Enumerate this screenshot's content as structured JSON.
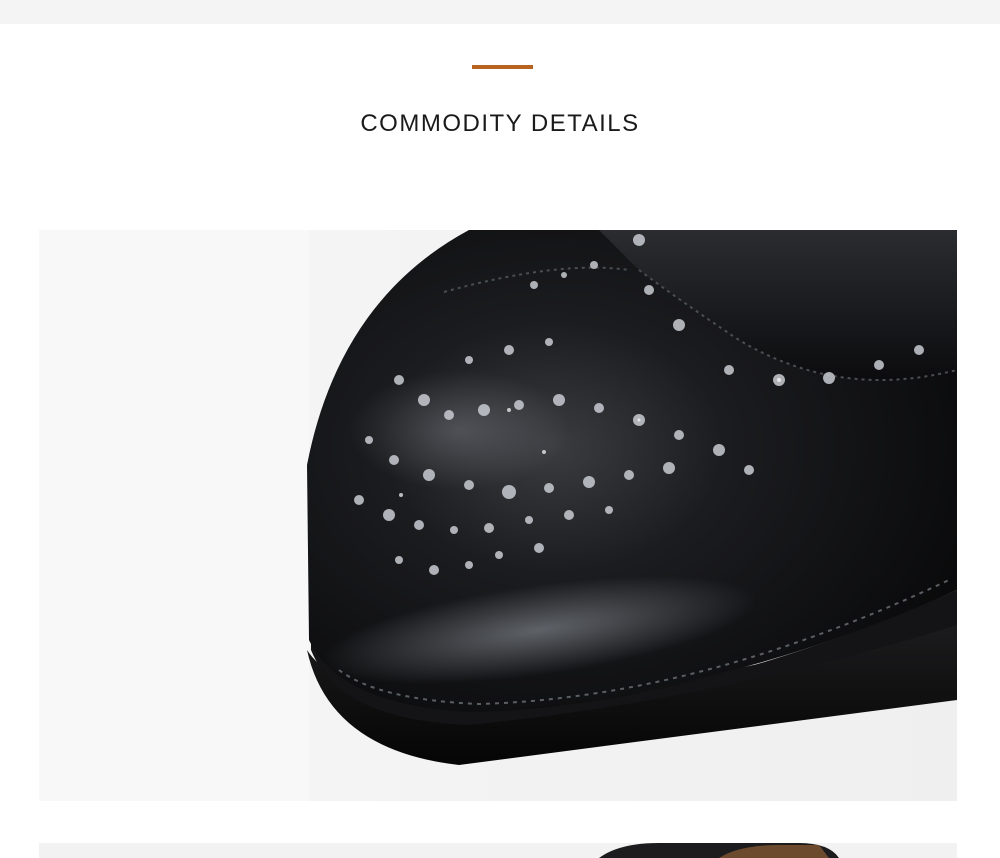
{
  "section": {
    "title": "COMMODITY DETAILS",
    "accent_color": "#b8621f"
  },
  "images": [
    {
      "name": "brogue-toe-closeup-photo",
      "subject": "black leather brogue shoe toe with perforations"
    },
    {
      "name": "next-detail-photo",
      "subject": "shoe detail (cropped)"
    }
  ]
}
